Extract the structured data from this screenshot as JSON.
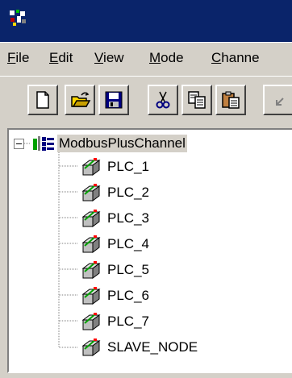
{
  "menu": {
    "items": [
      {
        "label_mn": "F",
        "label_rest": "ile"
      },
      {
        "label_mn": "E",
        "label_rest": "dit"
      },
      {
        "label_mn": "V",
        "label_rest": "iew"
      },
      {
        "label_mn": "M",
        "label_rest": "ode"
      },
      {
        "label_mn": "C",
        "label_rest": "hanne"
      }
    ]
  },
  "toolbar": {
    "buttons": [
      "new-icon",
      "open-icon",
      "save-icon",
      "cut-icon",
      "copy-icon",
      "paste-icon",
      "undo-icon"
    ]
  },
  "tree": {
    "root": {
      "label": "ModbusPlusChannel",
      "icon": "channel-icon",
      "expanded": true
    },
    "children": [
      {
        "label": "PLC_1",
        "icon": "device-icon"
      },
      {
        "label": "PLC_2",
        "icon": "device-icon"
      },
      {
        "label": "PLC_3",
        "icon": "device-icon"
      },
      {
        "label": "PLC_4",
        "icon": "device-icon"
      },
      {
        "label": "PLC_5",
        "icon": "device-icon"
      },
      {
        "label": "PLC_6",
        "icon": "device-icon"
      },
      {
        "label": "PLC_7",
        "icon": "device-icon"
      },
      {
        "label": "SLAVE_NODE",
        "icon": "device-icon"
      }
    ]
  },
  "colors": {
    "titlebar": "#0a246a",
    "face": "#d4d0c8",
    "tree_bg": "#ffffff"
  }
}
